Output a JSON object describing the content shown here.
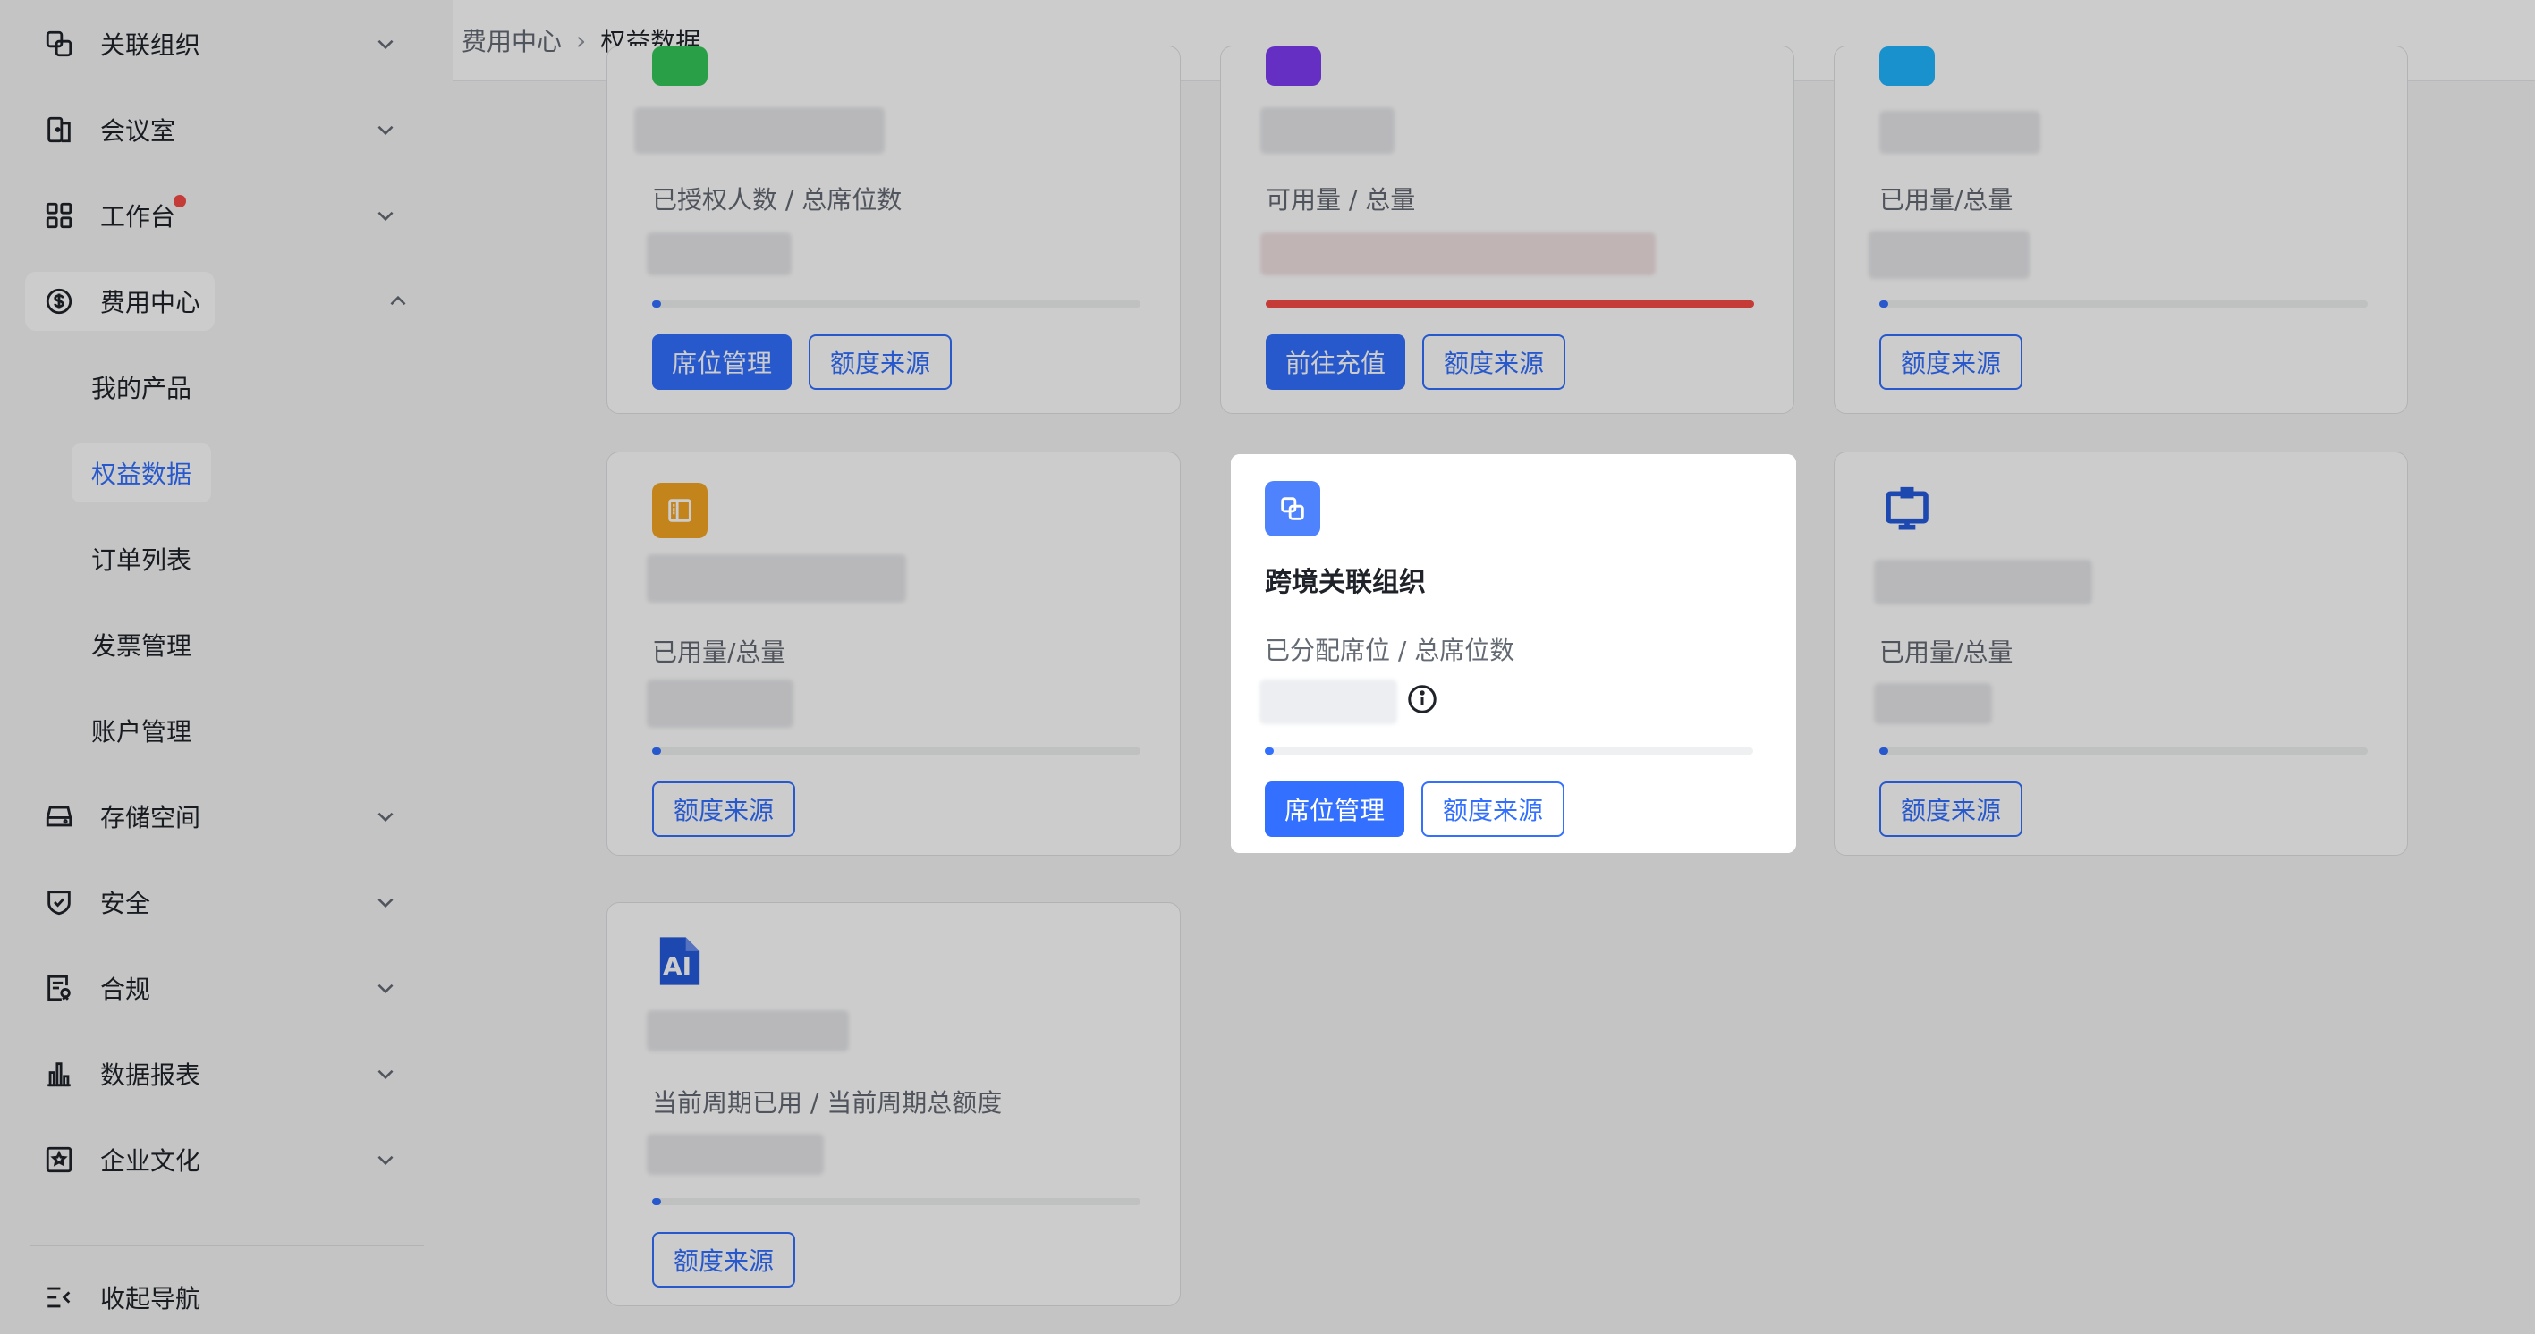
{
  "sidebar": {
    "items": [
      {
        "label": "关联组织",
        "icon": "link-org-icon"
      },
      {
        "label": "会议室",
        "icon": "meeting-room-icon"
      },
      {
        "label": "工作台",
        "icon": "workbench-icon"
      },
      {
        "label": "费用中心",
        "icon": "dollar-icon"
      },
      {
        "label": "存储空间",
        "icon": "storage-icon"
      },
      {
        "label": "安全",
        "icon": "shield-icon"
      },
      {
        "label": "合规",
        "icon": "compliance-icon"
      },
      {
        "label": "数据报表",
        "icon": "chart-icon"
      },
      {
        "label": "企业文化",
        "icon": "culture-icon"
      }
    ],
    "sub_items": [
      "我的产品",
      "权益数据",
      "订单列表",
      "发票管理",
      "账户管理"
    ],
    "collapse_label": "收起导航"
  },
  "header": {
    "breadcrumb": [
      "费用中心",
      "权益数据"
    ]
  },
  "cards": [
    {
      "metric": "已授权人数 / 总席位数",
      "buttons": [
        "席位管理",
        "额度来源"
      ],
      "progress": 0.01,
      "icon_color": "#34c759"
    },
    {
      "metric": "可用量 / 总量",
      "buttons": [
        "前往充值",
        "额度来源"
      ],
      "progress": 1.0,
      "icon_color": "#7f3bf5"
    },
    {
      "metric": "已用量/总量",
      "buttons": [
        "额度来源"
      ],
      "progress": 0.01,
      "icon_color": "#1fb6ff"
    },
    {
      "metric": "已用量/总量",
      "buttons": [
        "额度来源"
      ],
      "progress": 0.01,
      "icon_color": "#f5a623"
    },
    {
      "title": "跨境关联组织",
      "metric": "已分配席位 / 总席位数",
      "buttons": [
        "席位管理",
        "额度来源"
      ],
      "progress": 0.01,
      "icon_color": "#4e83fd"
    },
    {
      "metric": "已用量/总量",
      "buttons": [
        "额度来源"
      ],
      "progress": 0.01,
      "icon_color": "#245bdb"
    },
    {
      "metric": "当前周期已用 / 当前周期总额度",
      "buttons": [
        "额度来源"
      ],
      "progress": 0.01,
      "icon_color": "#245bdb",
      "icon_text": "AI"
    }
  ],
  "colors": {
    "accent": "#3370ff",
    "danger": "#f54a45",
    "mask": "rgba(0,0,0,0.2)"
  }
}
